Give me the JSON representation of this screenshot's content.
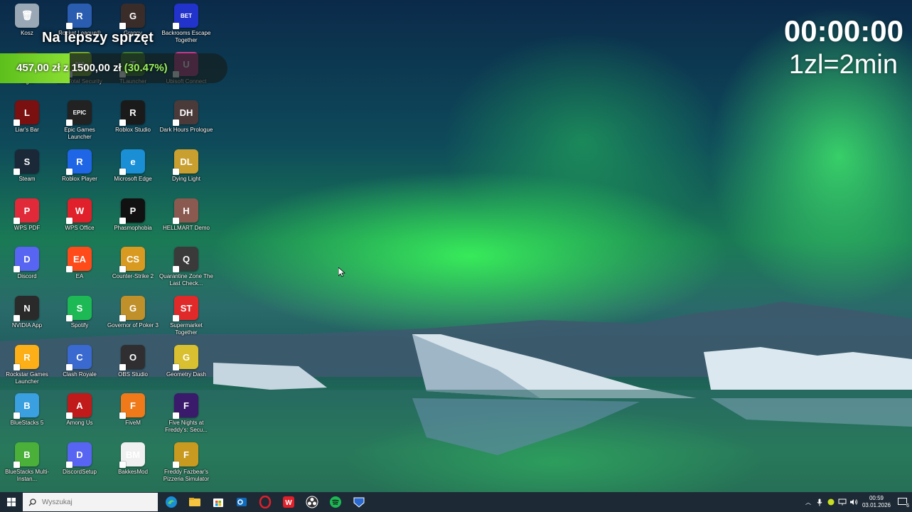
{
  "overlay": {
    "title": "Na lepszy sprzęt",
    "progress_text_current": "457,00 zł",
    "progress_text_sep": "z",
    "progress_text_goal": "1500,00 zł",
    "progress_text_percent": "(30.47%)",
    "progress_fraction": 0.3047,
    "timer": "00:00:00",
    "rate": "1zl=2min"
  },
  "desktop_icons": [
    {
      "label": "Kosz",
      "color": "#9aa8b5",
      "glyph": "🗑"
    },
    {
      "label": "Rocket League®",
      "color": "#2a5db0",
      "glyph": "R"
    },
    {
      "label": "Granny",
      "color": "#3a2c28",
      "glyph": "G"
    },
    {
      "label": "Backrooms Escape Together",
      "color": "#2233cc",
      "glyph": "BET"
    },
    {
      "label": "Night",
      "color": "#2e3a2e",
      "glyph": "N"
    },
    {
      "label": "360 Total Security",
      "color": "#7aa82a",
      "glyph": "360"
    },
    {
      "label": "TLauncher",
      "color": "#3d7a2e",
      "glyph": "T"
    },
    {
      "label": "Ubisoft Connect",
      "color": "#c03a8a",
      "glyph": "U"
    },
    {
      "label": "Liar's Bar",
      "color": "#7a1010",
      "glyph": "L"
    },
    {
      "label": "Epic Games Launcher",
      "color": "#222222",
      "glyph": "EPIC"
    },
    {
      "label": "Roblox Studio",
      "color": "#1a1a1a",
      "glyph": "R"
    },
    {
      "label": "Dark Hours Prologue",
      "color": "#4a3a3a",
      "glyph": "DH"
    },
    {
      "label": "Steam",
      "color": "#1b2838",
      "glyph": "S"
    },
    {
      "label": "Roblox Player",
      "color": "#1e66e6",
      "glyph": "R"
    },
    {
      "label": "Microsoft Edge",
      "color": "#1a8fd6",
      "glyph": "e"
    },
    {
      "label": "Dying Light",
      "color": "#c9a030",
      "glyph": "DL"
    },
    {
      "label": "WPS PDF",
      "color": "#e02a3a",
      "glyph": "P"
    },
    {
      "label": "WPS Office",
      "color": "#e0202a",
      "glyph": "W"
    },
    {
      "label": "Phasmophobia",
      "color": "#111111",
      "glyph": "P"
    },
    {
      "label": "HELLMART Demo",
      "color": "#8a5a50",
      "glyph": "H"
    },
    {
      "label": "Discord",
      "color": "#5865f2",
      "glyph": "D"
    },
    {
      "label": "EA",
      "color": "#ff4a1a",
      "glyph": "EA"
    },
    {
      "label": "Counter-Strike 2",
      "color": "#d89a20",
      "glyph": "CS"
    },
    {
      "label": "Quarantine Zone The Last Check...",
      "color": "#3a3a3a",
      "glyph": "Q"
    },
    {
      "label": "NVIDIA App",
      "color": "#2a2a2a",
      "glyph": "N"
    },
    {
      "label": "Spotify",
      "color": "#1db954",
      "glyph": "S"
    },
    {
      "label": "Governor of Poker 3",
      "color": "#c0902a",
      "glyph": "G"
    },
    {
      "label": "Supermarket Together",
      "color": "#e02a2a",
      "glyph": "ST"
    },
    {
      "label": "Rockstar Games Launcher",
      "color": "#fcaf17",
      "glyph": "R"
    },
    {
      "label": "Clash Royale",
      "color": "#3a6ad0",
      "glyph": "C"
    },
    {
      "label": "OBS Studio",
      "color": "#302e31",
      "glyph": "O"
    },
    {
      "label": "Geometry Dash",
      "color": "#d8c030",
      "glyph": "G"
    },
    {
      "label": "BlueStacks 5",
      "color": "#3aa0e0",
      "glyph": "B"
    },
    {
      "label": "Among Us",
      "color": "#c01a1a",
      "glyph": "A"
    },
    {
      "label": "FiveM",
      "color": "#f07a1a",
      "glyph": "F"
    },
    {
      "label": "Five Nights at Freddy's: Secu...",
      "color": "#3a1a6a",
      "glyph": "F"
    },
    {
      "label": "BlueStacks Multi-Instan...",
      "color": "#4ab03a",
      "glyph": "B"
    },
    {
      "label": "DiscordSetup",
      "color": "#5865f2",
      "glyph": "D"
    },
    {
      "label": "BakkesMod",
      "color": "#f0f0f0",
      "glyph": "BM"
    },
    {
      "label": "Freddy Fazbear's Pizzeria Simulator",
      "color": "#c89a20",
      "glyph": "F"
    }
  ],
  "taskbar": {
    "search_placeholder": "Wyszukaj",
    "apps": [
      "edge-icon",
      "file-explorer-icon",
      "store-icon",
      "outlook-icon",
      "opera-icon",
      "wps-icon",
      "obs-icon",
      "spotify-icon",
      "rocket-league-icon"
    ],
    "time": "00:59",
    "date": "03.01.2026",
    "notification_count": "6"
  },
  "colors": {
    "progress_fill": "#7ed321",
    "percent_text": "#9bf25a",
    "taskbar": "#1d2a36"
  }
}
